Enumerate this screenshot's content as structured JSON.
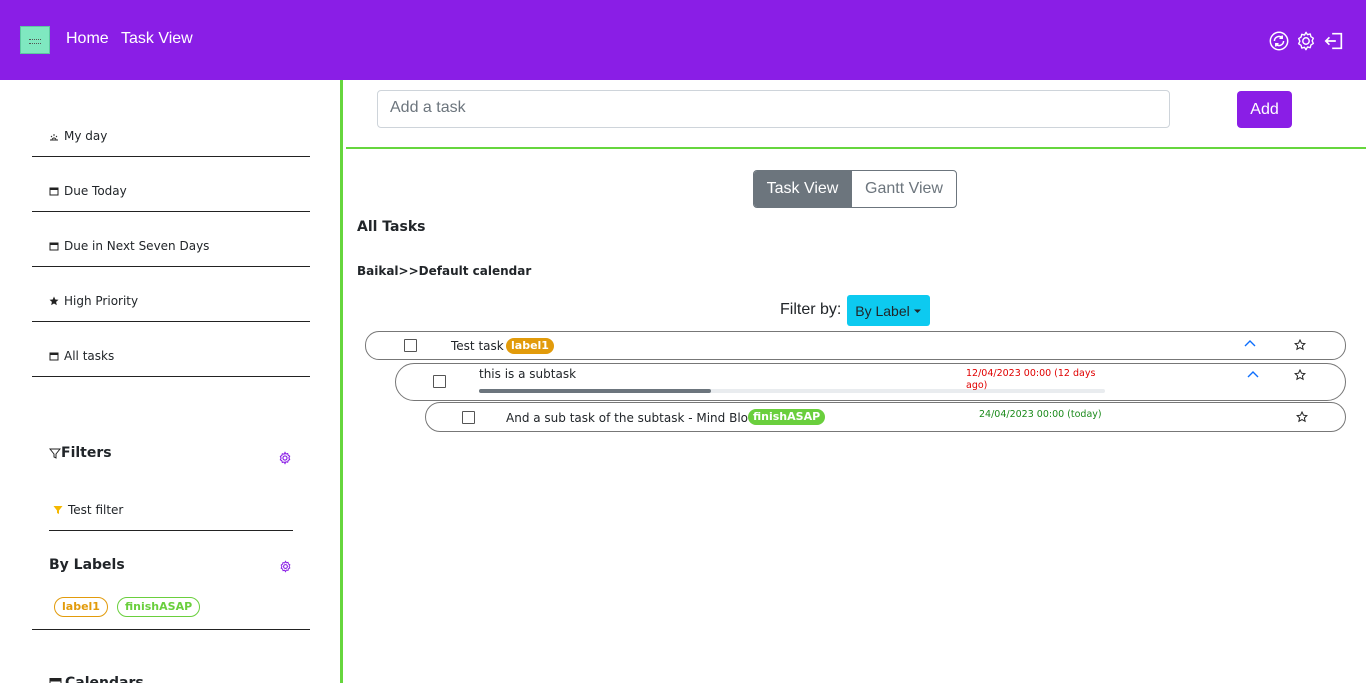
{
  "nav": {
    "home": "Home",
    "task_view": "Task View"
  },
  "sidebar": {
    "items": [
      {
        "label": "My day",
        "icon": "sun-icon"
      },
      {
        "label": "Due Today",
        "icon": "calendar-icon"
      },
      {
        "label": "Due in Next Seven Days",
        "icon": "calendar-icon"
      },
      {
        "label": "High Priority",
        "icon": "star-icon"
      },
      {
        "label": "All tasks",
        "icon": "calendar-icon"
      }
    ],
    "filters_title": "Filters",
    "filter_items": [
      "Test filter"
    ],
    "labels_title": "By Labels",
    "labels": [
      {
        "name": "label1",
        "color": "#e29b0b"
      },
      {
        "name": "finishASAP",
        "color": "#6acf3d"
      }
    ],
    "calendars_title": "Calendars"
  },
  "main": {
    "add_placeholder": "Add a task",
    "add_button": "Add",
    "view_toggle": {
      "task": "Task View",
      "gantt": "Gantt View"
    },
    "heading": "All Tasks",
    "calendar_path": "Baikal>>Default calendar",
    "filter_label": "Filter by:",
    "filter_value": "By Label",
    "tasks": [
      {
        "title": "Test task",
        "label": "label1"
      },
      {
        "title": "this is a subtask",
        "due": "12/04/2023 00:00 (12 days ago)",
        "progress": 0.37
      },
      {
        "title": "And a sub task of the subtask - Mind Blown!",
        "label": "finishASAP",
        "due": "24/04/2023 00:00 (today)"
      }
    ]
  },
  "colors": {
    "brand": "#8a1ee6",
    "accent_green": "#66d63d",
    "overdue": "#e00000",
    "due_today": "#1a8a1a",
    "info": "#0dcaf0"
  }
}
